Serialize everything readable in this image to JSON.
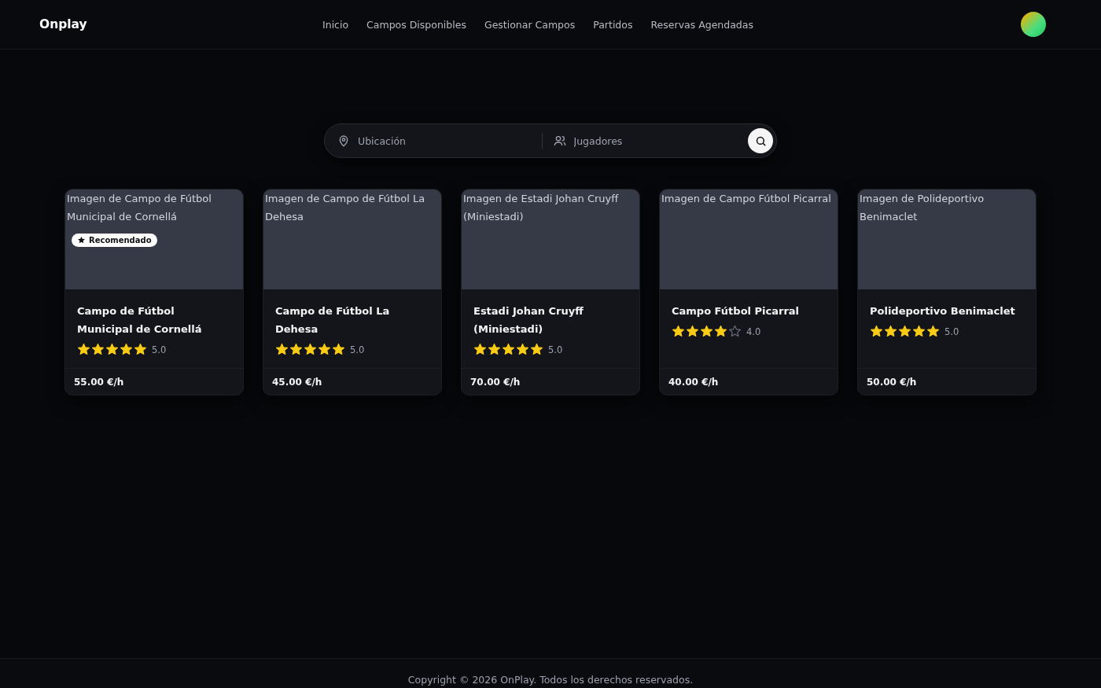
{
  "header": {
    "logo": "Onplay",
    "nav": [
      {
        "label": "Inicio"
      },
      {
        "label": "Campos Disponibles"
      },
      {
        "label": "Gestionar Campos"
      },
      {
        "label": "Partidos"
      },
      {
        "label": "Reservas Agendadas"
      }
    ]
  },
  "search": {
    "location_placeholder": "Ubicación",
    "players_placeholder": "Jugadores"
  },
  "fields": [
    {
      "image_alt": "Imagen de Campo de Fútbol Municipal de Cornellá",
      "badge": "Recomendado",
      "name": "Campo de Fútbol Municipal de Cornellá",
      "stars": 5,
      "rating": "5.0",
      "price": "55.00 €/h"
    },
    {
      "image_alt": "Imagen de Campo de Fútbol La Dehesa",
      "name": "Campo de Fútbol La Dehesa",
      "stars": 5,
      "rating": "5.0",
      "price": "45.00 €/h"
    },
    {
      "image_alt": "Imagen de Estadi Johan Cruyff (Miniestadi)",
      "name": "Estadi Johan Cruyff (Miniestadi)",
      "stars": 5,
      "rating": "5.0",
      "price": "70.00 €/h"
    },
    {
      "image_alt": "Imagen de Campo Fútbol Picarral",
      "name": "Campo Fútbol Picarral",
      "stars": 4,
      "rating": "4.0",
      "price": "40.00 €/h"
    },
    {
      "image_alt": "Imagen de Polideportivo Benimaclet",
      "name": "Polideportivo Benimaclet",
      "stars": 5,
      "rating": "5.0",
      "price": "50.00 €/h"
    }
  ],
  "footer": {
    "copyright": "Copyright © 2026 OnPlay. Todos los derechos reservados."
  }
}
